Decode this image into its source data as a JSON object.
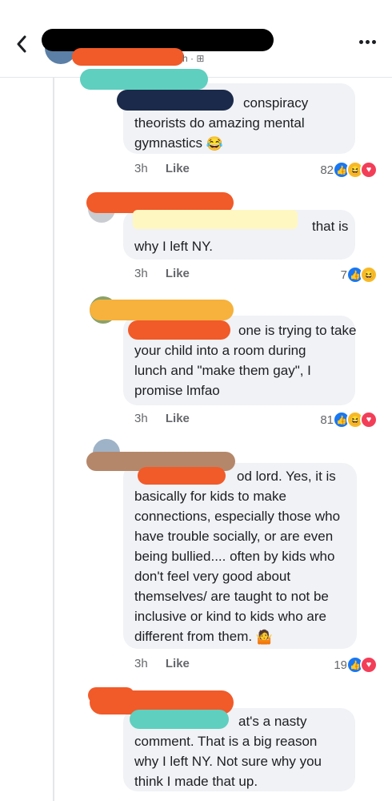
{
  "header": {
    "subtitle_suffix": "h ·",
    "colors": {
      "redaction_black": "#000000",
      "redaction_orange": "#f15a29"
    }
  },
  "comments": [
    {
      "lines": [
        "conspiracy",
        "theorists do amazing mental",
        "gymnastics"
      ],
      "time": "3h",
      "like_label": "Like",
      "reaction_count": "82",
      "reactions": [
        "like-icon",
        "haha-icon",
        "love-icon"
      ]
    },
    {
      "lines": [
        "that is",
        "why I left NY."
      ],
      "time": "3h",
      "like_label": "Like",
      "reaction_count": "7",
      "reactions": [
        "like-icon",
        "haha-icon"
      ]
    },
    {
      "lines": [
        "one is trying to take",
        "your child into a room during",
        "lunch and \"make them gay\", I",
        "promise lmfao"
      ],
      "time": "3h",
      "like_label": "Like",
      "reaction_count": "81",
      "reactions": [
        "like-icon",
        "haha-icon",
        "love-icon"
      ]
    },
    {
      "lines": [
        "od lord. Yes, it is",
        "basically for kids to make",
        "connections, especially those who",
        "have trouble socially, or are even",
        "being bullied.... often by kids who",
        "don't feel very good about",
        "themselves/ are taught to not be",
        "inclusive or kind to kids who are",
        "different from them."
      ],
      "time": "3h",
      "like_label": "Like",
      "reaction_count": "19",
      "reactions": [
        "like-icon",
        "love-icon"
      ]
    },
    {
      "lines": [
        "at's a nasty",
        "comment. That is a big reason",
        "why I left NY. Not sure why you",
        "think I made that up."
      ]
    }
  ],
  "redaction_colors": {
    "black": "#000000",
    "orange": "#f15a29",
    "teal": "#5fcfbf",
    "navy": "#1b2a4a",
    "yellow": "#fff7c2",
    "gold": "#f6b23c",
    "brown": "#b5876a"
  }
}
